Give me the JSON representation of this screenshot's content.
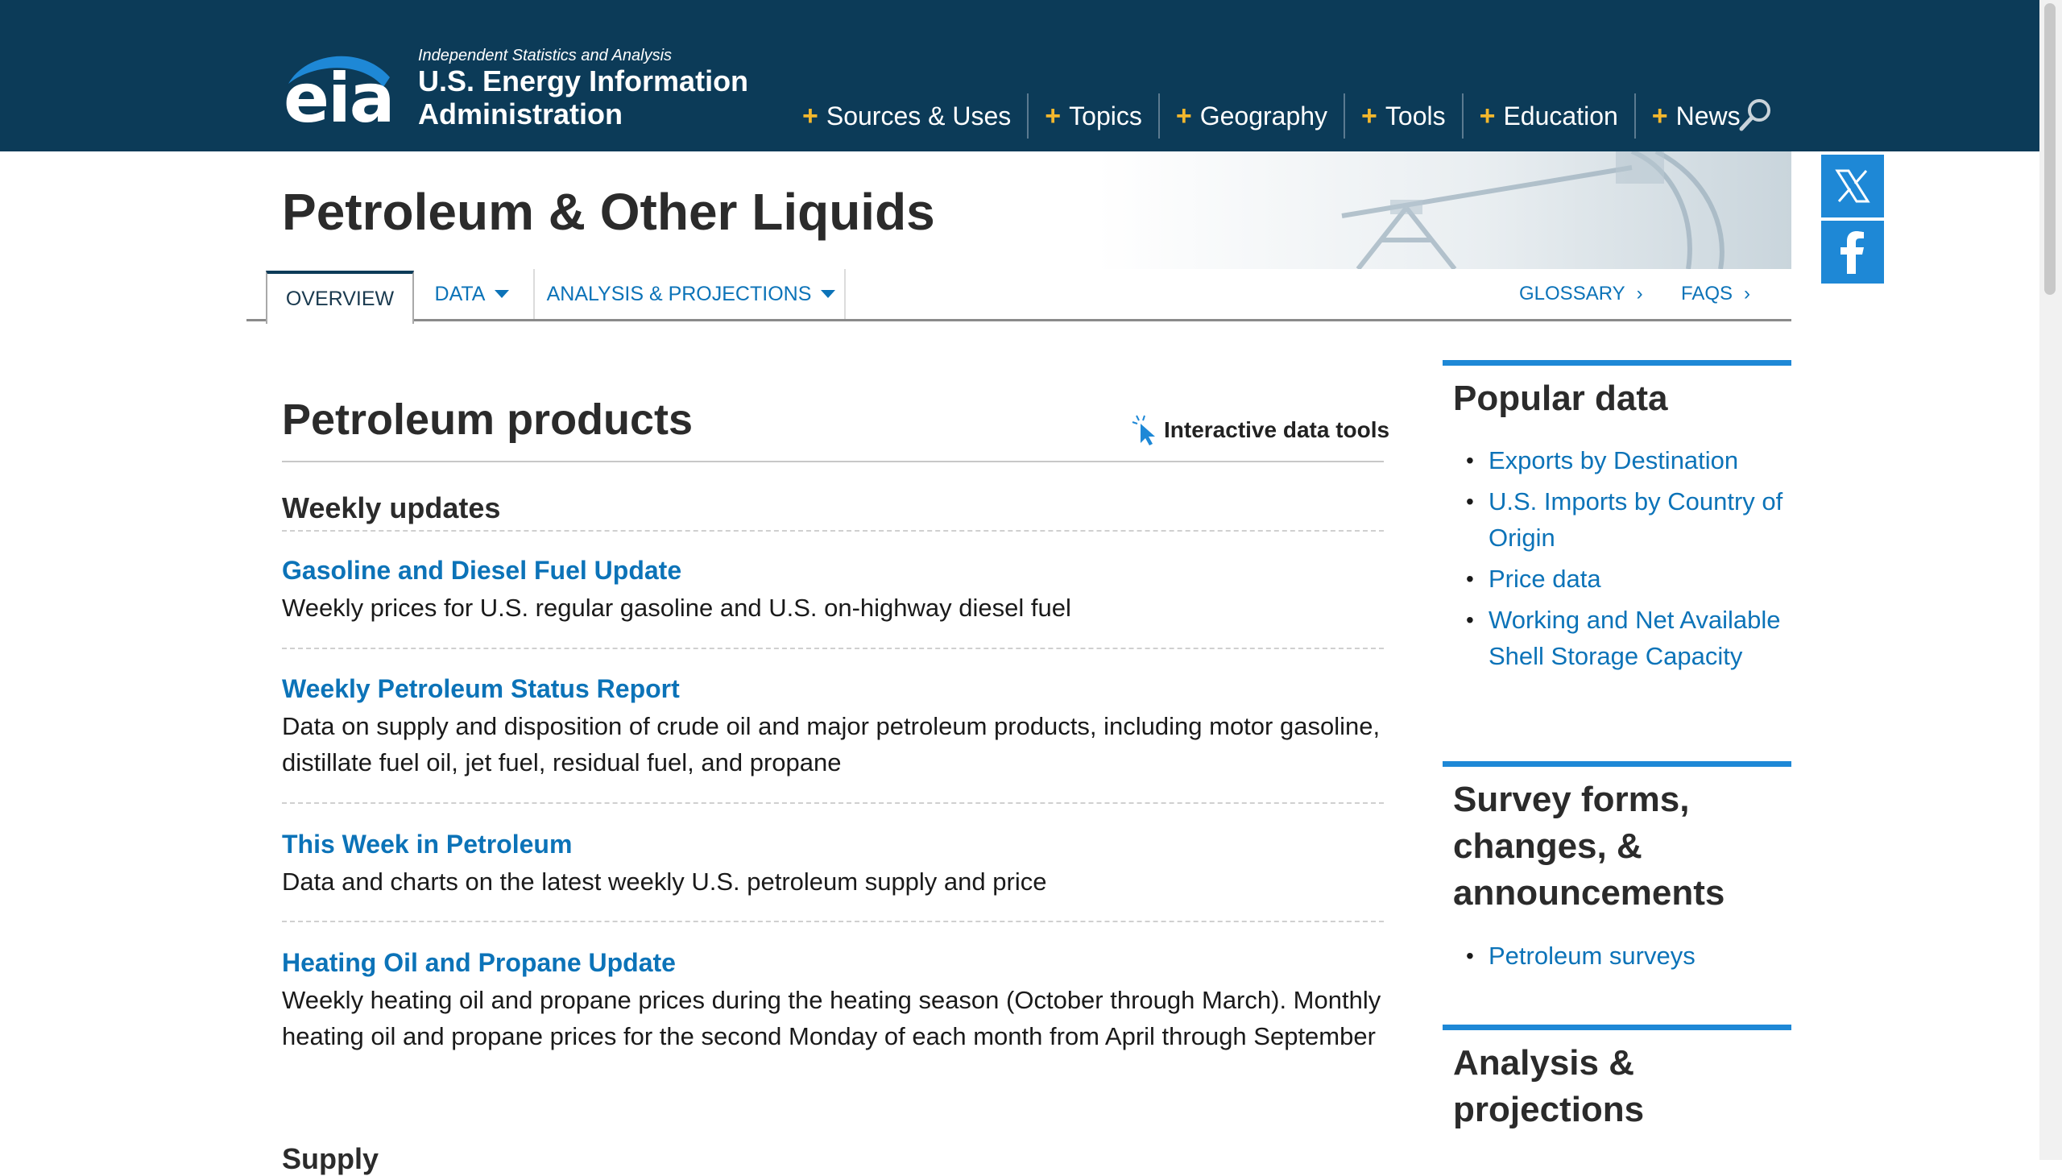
{
  "header": {
    "logo_text": "eia",
    "tagline": "Independent Statistics and Analysis",
    "agency_name": "U.S. Energy Information Administration",
    "nav": [
      {
        "label": "Sources & Uses"
      },
      {
        "label": "Topics"
      },
      {
        "label": "Geography"
      },
      {
        "label": "Tools"
      },
      {
        "label": "Education"
      },
      {
        "label": "News"
      }
    ],
    "nav_plus": "+"
  },
  "page": {
    "title": "Petroleum & Other Liquids"
  },
  "subnav": {
    "tabs": [
      {
        "label": "OVERVIEW"
      },
      {
        "label": "DATA"
      },
      {
        "label": "ANALYSIS & PROJECTIONS"
      }
    ],
    "glossary": "GLOSSARY",
    "faqs": "FAQS",
    "chevron": "›"
  },
  "main": {
    "section_title": "Petroleum products",
    "interactive_tools": "Interactive data tools",
    "weekly_heading": "Weekly updates",
    "items": [
      {
        "title": "Gasoline and Diesel Fuel Update",
        "desc": "Weekly prices for U.S. regular gasoline and U.S. on-highway diesel fuel"
      },
      {
        "title": "Weekly Petroleum Status Report",
        "desc": "Data on supply and disposition of crude oil and major petroleum products, including motor gasoline, distillate fuel oil, jet fuel, residual fuel, and propane"
      },
      {
        "title": "This Week in Petroleum",
        "desc": "Data and charts on the latest weekly U.S. petroleum supply and price"
      },
      {
        "title": "Heating Oil and Propane Update",
        "desc": "Weekly heating oil and propane prices during the heating season (October through March). Monthly heating oil and propane prices for the second Monday of each month from April through September"
      }
    ],
    "next_heading": "Supply"
  },
  "sidebar": {
    "popular": {
      "title": "Popular data",
      "links": [
        "Exports by Destination",
        "U.S. Imports by Country of Origin",
        "Price data",
        "Working and Net Available Shell Storage Capacity"
      ]
    },
    "survey": {
      "title": "Survey forms, changes, & announcements",
      "links": [
        "Petroleum surveys"
      ]
    },
    "analysis": {
      "title": "Analysis & projections"
    }
  },
  "icons": {
    "search": "search-icon",
    "x": "x-icon",
    "facebook": "facebook-icon",
    "cursor": "cursor-click-icon"
  },
  "colors": {
    "header_bg": "#0c3b58",
    "link": "#0c73b8",
    "accent": "#f3b72d",
    "social": "#1e88d6"
  }
}
